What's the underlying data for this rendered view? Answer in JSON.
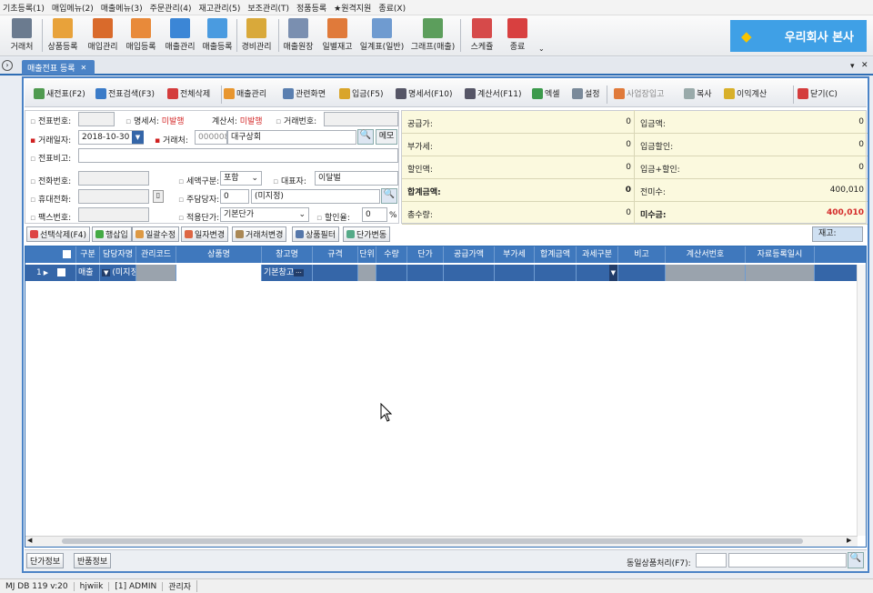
{
  "menu": [
    "기초등록(1)",
    "매입메뉴(2)",
    "매출메뉴(3)",
    "주문관리(4)",
    "재고관리(5)",
    "보조관리(T)",
    "정품등록",
    "★원격지원",
    "종료(X)"
  ],
  "toolbar": [
    {
      "label": "거래처",
      "color": "#6b7b8f"
    },
    {
      "label": "상품등록",
      "color": "#e8a23a"
    },
    {
      "label": "매입관리",
      "color": "#d96a2b"
    },
    {
      "label": "매입등록",
      "color": "#e88a3a"
    },
    {
      "label": "매출관리",
      "color": "#3b86d6"
    },
    {
      "label": "매출등록",
      "color": "#4a9be0"
    },
    {
      "label": "경비관리",
      "color": "#d9a93a"
    },
    {
      "label": "매출원장",
      "color": "#7a8fb0"
    },
    {
      "label": "일별재고",
      "color": "#e07a3a"
    },
    {
      "label": "일계표(일반)",
      "color": "#6f9bd0"
    },
    {
      "label": "그래프(매출)",
      "color": "#5c9e5c"
    },
    {
      "label": "스케쥴",
      "color": "#d64a4a"
    },
    {
      "label": "종료",
      "color": "#d84040"
    }
  ],
  "company": "우리회사 본사",
  "tab": "매출전표 등록",
  "actions": [
    {
      "label": "새전표(F2)",
      "color": "#4f9a4f"
    },
    {
      "label": "전표검색(F3)",
      "color": "#3a7bc8"
    },
    {
      "label": "전체삭제",
      "color": "#d43c3c"
    },
    {
      "label": "매출관리",
      "color": "#e8962f"
    },
    {
      "label": "관련화면",
      "color": "#5a7fb0"
    },
    {
      "label": "입금(F5)",
      "color": "#d9a52a"
    },
    {
      "label": "명세서(F10)",
      "color": "#556"
    },
    {
      "label": "계산서(F11)",
      "color": "#556"
    },
    {
      "label": "엑셀",
      "color": "#3c9a4c"
    },
    {
      "label": "설정",
      "color": "#7a8a9a"
    },
    {
      "label": "사업장입고",
      "color": "#e07a3a"
    },
    {
      "label": "복사",
      "color": "#9aa"
    },
    {
      "label": "이익계산",
      "color": "#d8b02a"
    },
    {
      "label": "닫기(C)",
      "color": "#d43c3c"
    }
  ],
  "form": {
    "voucher_no_label": "전표번호:",
    "statement_label": "명세서:",
    "statement_value": "미발행",
    "invoice_label": "계산서:",
    "invoice_value": "미발행",
    "trade_no_label": "거래번호:",
    "date_label": "거래일자:",
    "date_value": "2018-10-30",
    "client_label": "거래처:",
    "client_code": "000008",
    "client_name": "대구상회",
    "memo_btn": "메모",
    "note_label": "전표비고:",
    "phone_label": "전화번호:",
    "tax_label": "세액구분:",
    "tax_value": "포함",
    "ceo_label": "대표자:",
    "ceo_value": "이달벌",
    "mobile_label": "휴대전화:",
    "manager_label": "주담당자:",
    "manager_code": "0",
    "manager_name": "(미지정)",
    "fax_label": "팩스번호:",
    "price_label": "적용단가:",
    "price_value": "기본단가",
    "discount_label": "할인율:",
    "discount_value": "0",
    "percent": "%"
  },
  "summary": [
    {
      "left_label": "공급가:",
      "left_value": "0",
      "right_label": "입금액:",
      "right_value": "0"
    },
    {
      "left_label": "부가세:",
      "left_value": "0",
      "right_label": "입금할인:",
      "right_value": "0"
    },
    {
      "left_label": "할인액:",
      "left_value": "0",
      "right_label": "입금+할인:",
      "right_value": "0"
    },
    {
      "left_label": "합계금액:",
      "left_value": "0",
      "right_label": "전미수:",
      "right_value": "400,010"
    },
    {
      "left_label": "총수량:",
      "left_value": "0",
      "right_label": "미수금:",
      "right_value": "400,010"
    }
  ],
  "grid_buttons": [
    "선택삭제(F4)",
    "행삽입",
    "일괄수정",
    "일자변경",
    "거래처변경",
    "상품필터",
    "단가변동"
  ],
  "stock_label": "재고:",
  "columns": [
    "",
    "구분",
    "담당자명",
    "관리코드",
    "상품명",
    "창고명",
    "규격",
    "단위",
    "수량",
    "단가",
    "공급가액",
    "부가세",
    "합계금액",
    "과세구분",
    "비고",
    "계산서번호",
    "자료등록일시"
  ],
  "row": {
    "index": "1",
    "type": "매출",
    "manager": "(미지정)",
    "code": "",
    "product": "",
    "warehouse": "기본창고"
  },
  "bottom": {
    "unit_btn": "단가정보",
    "return_btn": "반품정보",
    "same_label": "동일상품처리(F7):"
  },
  "status": [
    "MJ DB 119 v:20",
    "hjwiik",
    "[1] ADMIN",
    "관리자"
  ]
}
